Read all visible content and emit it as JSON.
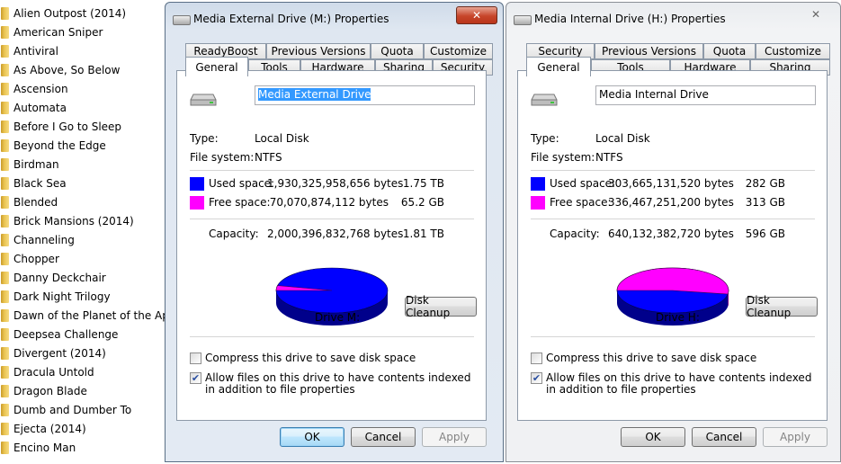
{
  "folders": [
    "Alien Outpost (2014)",
    "American Sniper",
    "Antiviral",
    "As Above, So Below",
    "Ascension",
    "Automata",
    "Before I Go to Sleep",
    "Beyond the Edge",
    "Birdman",
    "Black Sea",
    "Blended",
    "Brick Mansions (2014)",
    "Channeling",
    "Chopper",
    "Danny Deckchair",
    "Dark Night Trilogy",
    "Dawn of the Planet of the Apes",
    "Deepsea Challenge",
    "Divergent (2014)",
    "Dracula Untold",
    "Dragon Blade",
    "Dumb and Dumber To",
    "Ejecta (2014)",
    "Encino Man"
  ],
  "dialog_external": {
    "title": "Media External Drive (M:) Properties",
    "tabs_top": [
      "ReadyBoost",
      "Previous Versions",
      "Quota",
      "Customize"
    ],
    "tabs_bottom": [
      "General",
      "Tools",
      "Hardware",
      "Sharing",
      "Security"
    ],
    "name_value": "Media External Drive",
    "type_label": "Type:",
    "type_value": "Local Disk",
    "fs_label": "File system:",
    "fs_value": "NTFS",
    "used_label": "Used space:",
    "used_bytes": "1,930,325,958,656 bytes",
    "used_size": "1.75 TB",
    "free_label": "Free space:",
    "free_bytes": "70,070,874,112 bytes",
    "free_size": "65.2 GB",
    "capacity_label": "Capacity:",
    "capacity_bytes": "2,000,396,832,768 bytes",
    "capacity_size": "1.81 TB",
    "used_fraction": 0.965,
    "drive_label": "Drive M:",
    "cleanup_label": "Disk Cleanup",
    "compress_label": "Compress this drive to save disk space",
    "compress_checked": false,
    "index_label": "Allow files on this drive to have contents indexed in addition to file properties",
    "index_checked": true,
    "ok_label": "OK",
    "cancel_label": "Cancel",
    "apply_label": "Apply"
  },
  "dialog_internal": {
    "title": "Media Internal Drive (H:) Properties",
    "tabs_top": [
      "Security",
      "Previous Versions",
      "Quota",
      "Customize"
    ],
    "tabs_bottom": [
      "General",
      "Tools",
      "Hardware",
      "Sharing"
    ],
    "name_value": "Media Internal Drive",
    "type_label": "Type:",
    "type_value": "Local Disk",
    "fs_label": "File system:",
    "fs_value": "NTFS",
    "used_label": "Used space:",
    "used_bytes": "303,665,131,520 bytes",
    "used_size": "282 GB",
    "free_label": "Free space:",
    "free_bytes": "336,467,251,200 bytes",
    "free_size": "313 GB",
    "capacity_label": "Capacity:",
    "capacity_bytes": "640,132,382,720 bytes",
    "capacity_size": "596 GB",
    "used_fraction": 0.474,
    "drive_label": "Drive H:",
    "cleanup_label": "Disk Cleanup",
    "compress_label": "Compress this drive to save disk space",
    "compress_checked": false,
    "index_label": "Allow files on this drive to have contents indexed in addition to file properties",
    "index_checked": true,
    "ok_label": "OK",
    "cancel_label": "Cancel",
    "apply_label": "Apply"
  },
  "colors": {
    "used": "#0000ff",
    "free": "#ff00ff",
    "used_dark": "#00008b",
    "free_dark": "#8b008b"
  },
  "close_glyph": "✕",
  "check_glyph": "✔"
}
